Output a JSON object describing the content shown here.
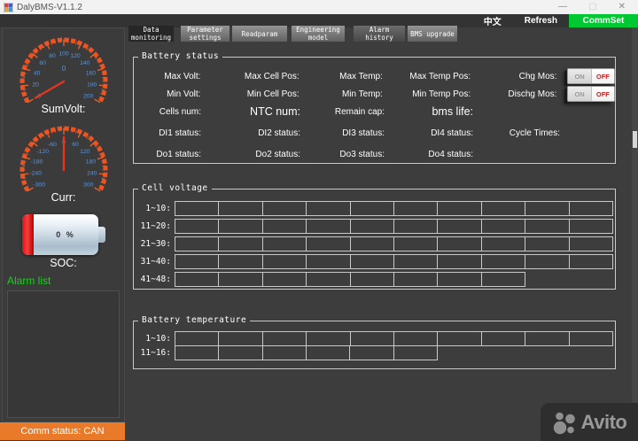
{
  "window": {
    "title": "DalyBMS-V1.1.2",
    "controls": {
      "minimize": "—",
      "maximize": "▢",
      "close": "✕"
    }
  },
  "toolbar": {
    "language": "中文",
    "refresh": "Refresh",
    "commset": "CommSet"
  },
  "colors": {
    "commset_green": "#00c832",
    "comm_bar_orange": "#e87a2a",
    "gauge_arc_orange": "#f1511f",
    "gauge_number_blue": "#5b95d6",
    "needle_red": "#e5341f",
    "off_red": "#c02020",
    "alarm_green": "#17d317"
  },
  "tabs": [
    {
      "label": "Data monitoring",
      "active": true
    },
    {
      "label": "Parameter settings"
    },
    {
      "label": "Readparam"
    },
    {
      "label": "Engineering model"
    },
    {
      "label": "Alarm history",
      "dark": true
    },
    {
      "label": "BMS upgrade"
    }
  ],
  "sidebar": {
    "gauges": [
      {
        "label": "SumVolt:",
        "value": "0",
        "min": 0,
        "max": 200,
        "tick_step": 20,
        "ticks": [
          0,
          20,
          40,
          60,
          80,
          100,
          120,
          140,
          160,
          180,
          200
        ],
        "needle": 0
      },
      {
        "label": "Curr:",
        "value": "",
        "min": -300,
        "max": 300,
        "tick_step": 60,
        "ticks": [
          -300,
          -240,
          -180,
          -120,
          -60,
          0,
          60,
          120,
          180,
          240,
          300
        ],
        "needle": 0
      }
    ],
    "battery": {
      "percent": "0 %",
      "label": "SOC:"
    },
    "alarm_list_label": "Alarm list",
    "comm_status": "Comm status: CAN"
  },
  "battery_status": {
    "title": "Battery status",
    "rows": [
      [
        "Max Volt:",
        "Max Cell Pos:",
        "Max Temp:",
        "Max Temp Pos:",
        "Chg Mos:"
      ],
      [
        "Min Volt:",
        "Min Cell Pos:",
        "Min Temp:",
        "Min Temp Pos:",
        "Dischg Mos:"
      ],
      [
        "Cells num:",
        {
          "label": "NTC num:",
          "large": true
        },
        "Remain cap:",
        {
          "label": "bms life:",
          "large": true
        },
        ""
      ],
      [
        "DI1 status:",
        "DI2 status:",
        "DI3 status:",
        "DI4 status:",
        "Cycle Times:"
      ],
      [
        "Do1 status:",
        "Do2 status:",
        "Do3 status:",
        "Do4 status:",
        ""
      ]
    ],
    "toggle": {
      "on": "ON",
      "off": "OFF",
      "state": "off"
    },
    "toggle_rows": [
      0,
      1
    ],
    "toggle_names": [
      "toggle-chg-mos",
      "toggle-dischg-mos"
    ]
  },
  "cell_voltage": {
    "title": "Cell voltage",
    "rows": [
      {
        "label": "1~10:",
        "cells": 10
      },
      {
        "label": "11~20:",
        "cells": 10
      },
      {
        "label": "21~30:",
        "cells": 10
      },
      {
        "label": "31~40:",
        "cells": 10
      },
      {
        "label": "41~48:",
        "cells": 8
      }
    ]
  },
  "battery_temperature": {
    "title": "Battery temperature",
    "rows": [
      {
        "label": "1~10:",
        "cells": 10
      },
      {
        "label": "11~16:",
        "cells": 6
      }
    ]
  },
  "watermark": {
    "brand": "Avito"
  }
}
